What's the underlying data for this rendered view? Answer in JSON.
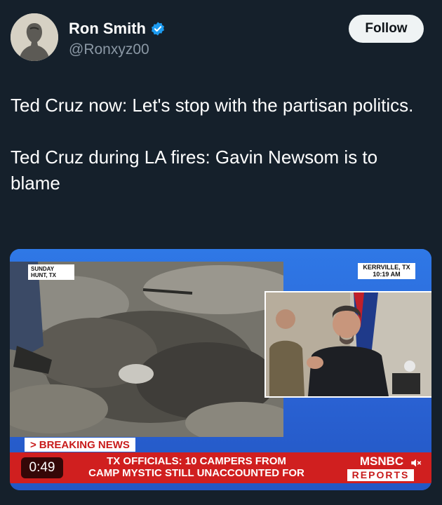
{
  "author": {
    "name": "Ron Smith",
    "handle": "@Ronxyz00",
    "verified_icon": "verified-badge-icon",
    "verified_color": "#1d9bf0"
  },
  "follow_label": "Follow",
  "tweet": {
    "paragraphs": [
      "Ted Cruz now: Let's stop with the partisan politics.",
      "Ted Cruz during LA fires: Gavin Newsom is to blame"
    ]
  },
  "video": {
    "left_location": "SUNDAY\nHUNT, TX",
    "right_location_line1": "KERRVILLE, TX",
    "right_location_line2": "10:19 AM",
    "breaking_label": "BREAKING NEWS",
    "headline_line1": "TX OFFICIALS: 10 CAMPERS FROM",
    "headline_line2": "CAMP MYSTIC STILL UNACCOUNTED FOR",
    "duration": "0:49",
    "network": "MSNBC",
    "program": "REPORTS",
    "accent_red": "#d01f1f",
    "accent_blue": "#2a66d6"
  }
}
